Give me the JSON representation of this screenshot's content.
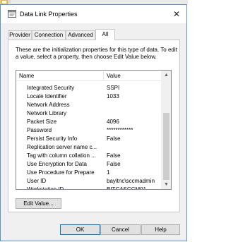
{
  "window": {
    "title": "Data Link Properties",
    "close_glyph": "✕"
  },
  "tabs": [
    {
      "label": "Provider",
      "active": false
    },
    {
      "label": "Connection",
      "active": false
    },
    {
      "label": "Advanced",
      "active": false
    },
    {
      "label": "All",
      "active": true
    }
  ],
  "intro_text": "These are the initialization properties for this type of data. To edit a value, select a property, then choose Edit Value below.",
  "list": {
    "headers": {
      "name": "Name",
      "value": "Value"
    },
    "rows": [
      {
        "name": "Integrated Security",
        "value": "SSPI"
      },
      {
        "name": "Locale Identifier",
        "value": "1033"
      },
      {
        "name": "Network Address",
        "value": ""
      },
      {
        "name": "Network Library",
        "value": ""
      },
      {
        "name": "Packet Size",
        "value": "4096"
      },
      {
        "name": "Password",
        "value": "************"
      },
      {
        "name": "Persist Security Info",
        "value": "False"
      },
      {
        "name": "Replication server name c...",
        "value": ""
      },
      {
        "name": "Tag with column collation ...",
        "value": "False"
      },
      {
        "name": "Use Encryption for Data",
        "value": "False"
      },
      {
        "name": "Use Procedure for Prepare",
        "value": "1"
      },
      {
        "name": "User ID",
        "value": "bayitnc\\sccmadmin"
      },
      {
        "name": "Workstation ID",
        "value": "BITCASCCM01"
      }
    ],
    "scroll_up_glyph": "▲",
    "scroll_down_glyph": "▼"
  },
  "buttons": {
    "edit_value": "Edit Value...",
    "ok": "OK",
    "cancel": "Cancel",
    "help": "Help"
  },
  "icons": {
    "title_icon": "data-link-icon",
    "desktop_icon": "desktop-file-icon"
  },
  "colors": {
    "window_border": "#5f8fd0",
    "default_button_border": "#0078d7"
  }
}
